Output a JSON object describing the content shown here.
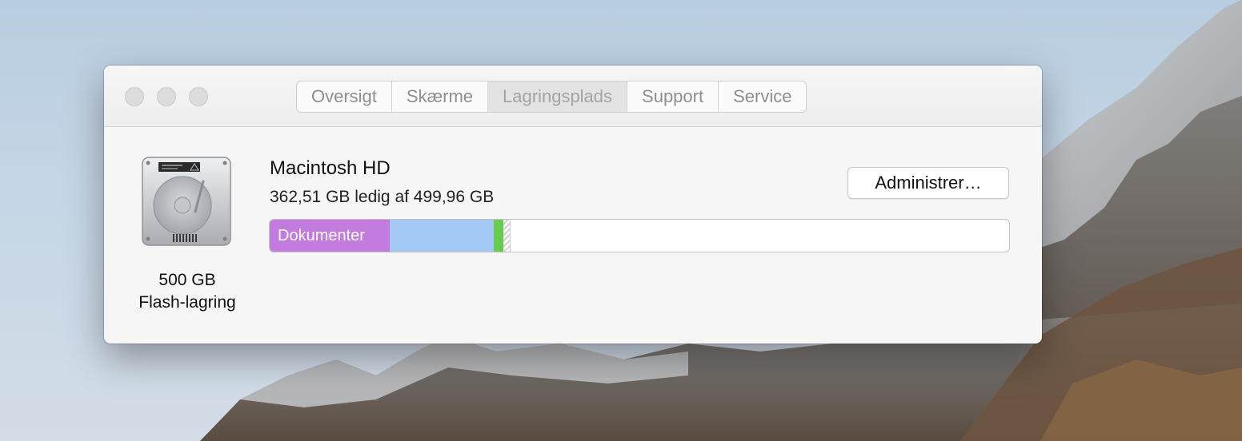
{
  "window": {
    "tabs": [
      {
        "label": "Oversigt",
        "selected": false
      },
      {
        "label": "Skærme",
        "selected": false
      },
      {
        "label": "Lagringsplads",
        "selected": true
      },
      {
        "label": "Support",
        "selected": false
      },
      {
        "label": "Service",
        "selected": false
      }
    ]
  },
  "disk": {
    "name": "Macintosh HD",
    "free_text": "362,51 GB ledig af 499,96 GB",
    "size": "500 GB",
    "type": "Flash-lagring",
    "icon": "hard-drive-icon"
  },
  "manage_button": {
    "label": "Administrer…"
  },
  "storage_bar": {
    "total_gb": 499.96,
    "free_gb": 362.51,
    "segments": [
      {
        "name": "documents",
        "label": "Dokumenter",
        "fraction": 0.162,
        "color": "#c47be0"
      },
      {
        "name": "other",
        "label": "",
        "fraction": 0.141,
        "color": "#a4c9f5"
      },
      {
        "name": "apps",
        "label": "",
        "fraction": 0.013,
        "color": "#66cc4c"
      },
      {
        "name": "purgeable",
        "label": "",
        "fraction": 0.01,
        "color": "hatched"
      }
    ]
  },
  "colors": {
    "window_bg": "#f6f6f6",
    "traffic_light_inactive": "#dcdcdc"
  }
}
